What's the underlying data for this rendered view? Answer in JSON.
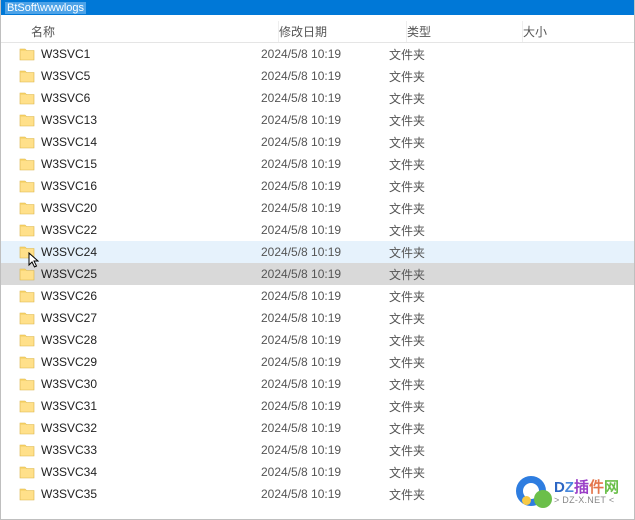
{
  "pathbar": {
    "text": "BtSoft\\wwwlogs"
  },
  "headers": {
    "name": "名称",
    "date": "修改日期",
    "type": "类型",
    "size": "大小"
  },
  "folderType": "文件夹",
  "files": [
    {
      "name": "W3SVC1",
      "date": "2024/5/8 10:19"
    },
    {
      "name": "W3SVC5",
      "date": "2024/5/8 10:19"
    },
    {
      "name": "W3SVC6",
      "date": "2024/5/8 10:19"
    },
    {
      "name": "W3SVC13",
      "date": "2024/5/8 10:19"
    },
    {
      "name": "W3SVC14",
      "date": "2024/5/8 10:19"
    },
    {
      "name": "W3SVC15",
      "date": "2024/5/8 10:19"
    },
    {
      "name": "W3SVC16",
      "date": "2024/5/8 10:19"
    },
    {
      "name": "W3SVC20",
      "date": "2024/5/8 10:19"
    },
    {
      "name": "W3SVC22",
      "date": "2024/5/8 10:19"
    },
    {
      "name": "W3SVC24",
      "date": "2024/5/8 10:19",
      "highlight": true,
      "cursor": true
    },
    {
      "name": "W3SVC25",
      "date": "2024/5/8 10:19",
      "selected": true
    },
    {
      "name": "W3SVC26",
      "date": "2024/5/8 10:19"
    },
    {
      "name": "W3SVC27",
      "date": "2024/5/8 10:19"
    },
    {
      "name": "W3SVC28",
      "date": "2024/5/8 10:19"
    },
    {
      "name": "W3SVC29",
      "date": "2024/5/8 10:19"
    },
    {
      "name": "W3SVC30",
      "date": "2024/5/8 10:19"
    },
    {
      "name": "W3SVC31",
      "date": "2024/5/8 10:19"
    },
    {
      "name": "W3SVC32",
      "date": "2024/5/8 10:19"
    },
    {
      "name": "W3SVC33",
      "date": "2024/5/8 10:19"
    },
    {
      "name": "W3SVC34",
      "date": "2024/5/8 10:19"
    },
    {
      "name": "W3SVC35",
      "date": "2024/5/8 10:19"
    }
  ],
  "watermark": {
    "main": "DZ插件网",
    "url": "> DZ-X.NET <"
  }
}
